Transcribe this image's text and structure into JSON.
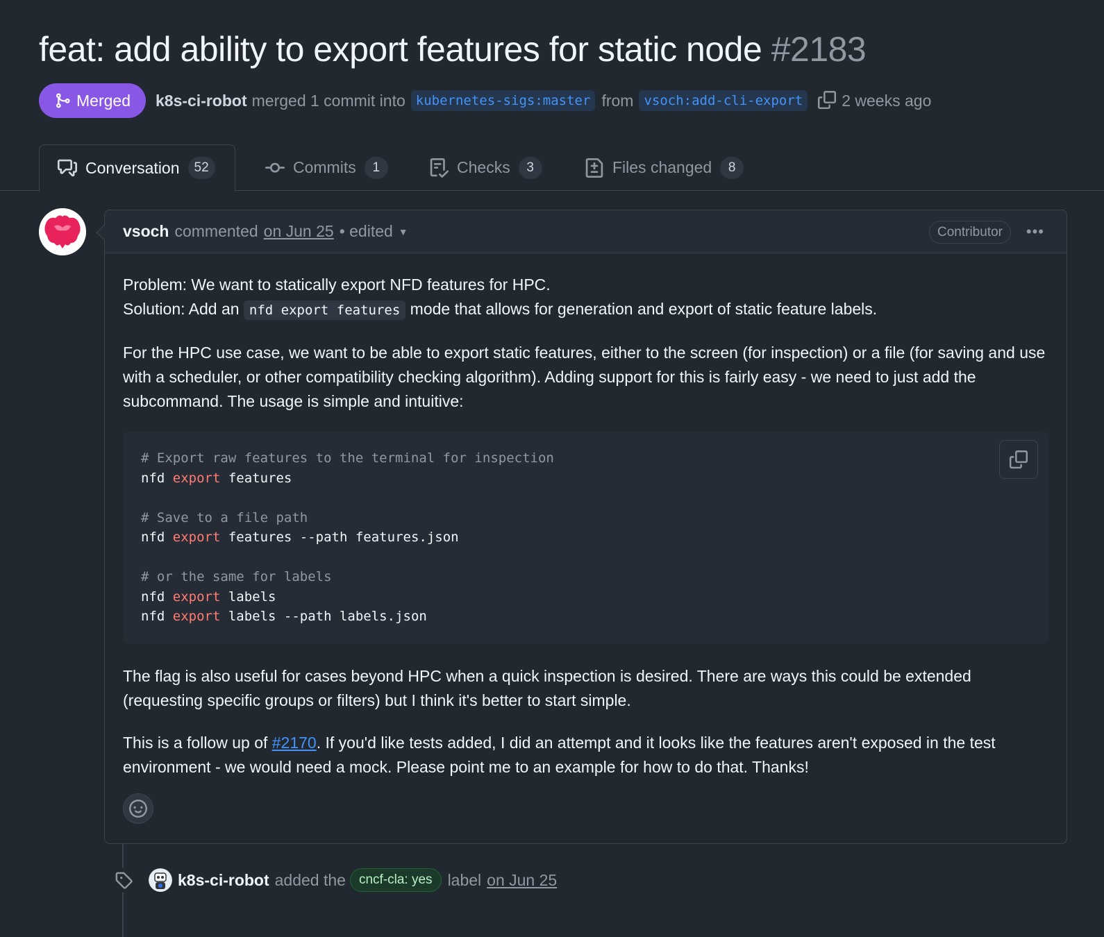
{
  "pr": {
    "title": "feat: add ability to export features for static node",
    "number": "#2183",
    "state": "Merged",
    "merged_by": "k8s-ci-robot",
    "merged_text": "merged 1 commit into",
    "base_branch": "kubernetes-sigs:master",
    "from_text": "from",
    "head_branch": "vsoch:add-cli-export",
    "time_ago": "2 weeks ago"
  },
  "tabs": [
    {
      "label": "Conversation",
      "count": "52",
      "icon": "comment-discussion-icon"
    },
    {
      "label": "Commits",
      "count": "1",
      "icon": "git-commit-icon"
    },
    {
      "label": "Checks",
      "count": "3",
      "icon": "checklist-icon"
    },
    {
      "label": "Files changed",
      "count": "8",
      "icon": "file-diff-icon"
    }
  ],
  "comment": {
    "author": "vsoch",
    "action": "commented",
    "date": "on Jun 25",
    "edited": "• edited",
    "role": "Contributor",
    "problem": "Problem: We want to statically export NFD features for HPC.",
    "solution_pre": "Solution: Add an",
    "solution_code": "nfd export features",
    "solution_post": "mode that allows for generation and export of static feature labels.",
    "para2": "For the HPC use case, we want to be able to export static features, either to the screen (for inspection) or a file (for saving and use with a scheduler, or other compatibility checking algorithm). Adding support for this is fairly easy - we need to just add the subcommand. The usage is simple and intuitive:",
    "code": {
      "c1": "# Export raw features to the terminal for inspection",
      "l1a": "nfd ",
      "l1k": "export",
      "l1b": " features",
      "c2": "# Save to a file path",
      "l2a": "nfd ",
      "l2k": "export",
      "l2b": " features --path features.json",
      "c3": "# or the same for labels",
      "l3a": "nfd ",
      "l3k": "export",
      "l3b": " labels",
      "l4a": "nfd ",
      "l4k": "export",
      "l4b": " labels --path labels.json"
    },
    "para3": "The flag is also useful for cases beyond HPC when a quick inspection is desired. There are ways this could be extended (requesting specific groups or filters) but I think it's better to start simple.",
    "para4_pre": "This is a follow up of ",
    "para4_link": "#2170",
    "para4_post": ". If you'd like tests added, I did an attempt and it looks like the features aren't exposed in the test environment - we would need a mock. Please point me to an example for how to do that. Thanks!"
  },
  "event": {
    "actor": "k8s-ci-robot",
    "text1": "added the",
    "label": "cncf-cla: yes",
    "text2": "label",
    "date": "on Jun 25"
  },
  "colors": {
    "background": "#212830",
    "merged": "#8957e5",
    "link": "#4493f8",
    "keyword": "#ff7b72"
  }
}
